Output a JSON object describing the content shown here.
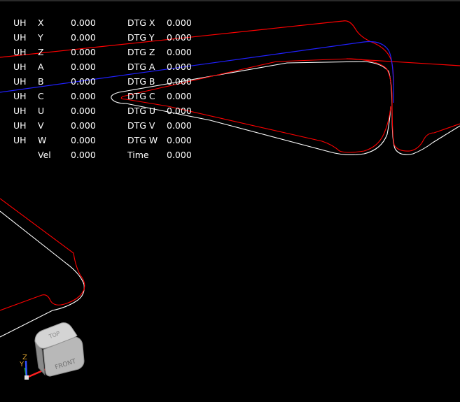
{
  "dro": {
    "rows": [
      {
        "homed": "UH",
        "axis": "X",
        "value": "0.000",
        "dtg_label": "DTG X",
        "dtg_value": "0.000"
      },
      {
        "homed": "UH",
        "axis": "Y",
        "value": "0.000",
        "dtg_label": "DTG Y",
        "dtg_value": "0.000"
      },
      {
        "homed": "UH",
        "axis": "Z",
        "value": "0.000",
        "dtg_label": "DTG Z",
        "dtg_value": "0.000"
      },
      {
        "homed": "UH",
        "axis": "A",
        "value": "0.000",
        "dtg_label": "DTG A",
        "dtg_value": "0.000"
      },
      {
        "homed": "UH",
        "axis": "B",
        "value": "0.000",
        "dtg_label": "DTG B",
        "dtg_value": "0.000"
      },
      {
        "homed": "UH",
        "axis": "C",
        "value": "0.000",
        "dtg_label": "DTG C",
        "dtg_value": "0.000"
      },
      {
        "homed": "UH",
        "axis": "U",
        "value": "0.000",
        "dtg_label": "DTG U",
        "dtg_value": "0.000"
      },
      {
        "homed": "UH",
        "axis": "V",
        "value": "0.000",
        "dtg_label": "DTG V",
        "dtg_value": "0.000"
      },
      {
        "homed": "UH",
        "axis": "W",
        "value": "0.000",
        "dtg_label": "DTG W",
        "dtg_value": "0.000"
      }
    ],
    "vel_label": "Vel",
    "vel_value": "0.000",
    "time_label": "Time",
    "time_value": "0.000"
  },
  "view_cube": {
    "top_label": "TOP",
    "front_label": "FRONT"
  },
  "axes_triad": {
    "z_label": "Z",
    "y_label": "Y",
    "x_color": "#ff2020",
    "y_color": "#20d020",
    "z_color": "#3050ff"
  },
  "colors": {
    "background": "#000000",
    "feed_path": "#ff0000",
    "traverse_path": "#2020ff",
    "part_outline": "#ffffff",
    "dro_text": "#ffffff"
  }
}
